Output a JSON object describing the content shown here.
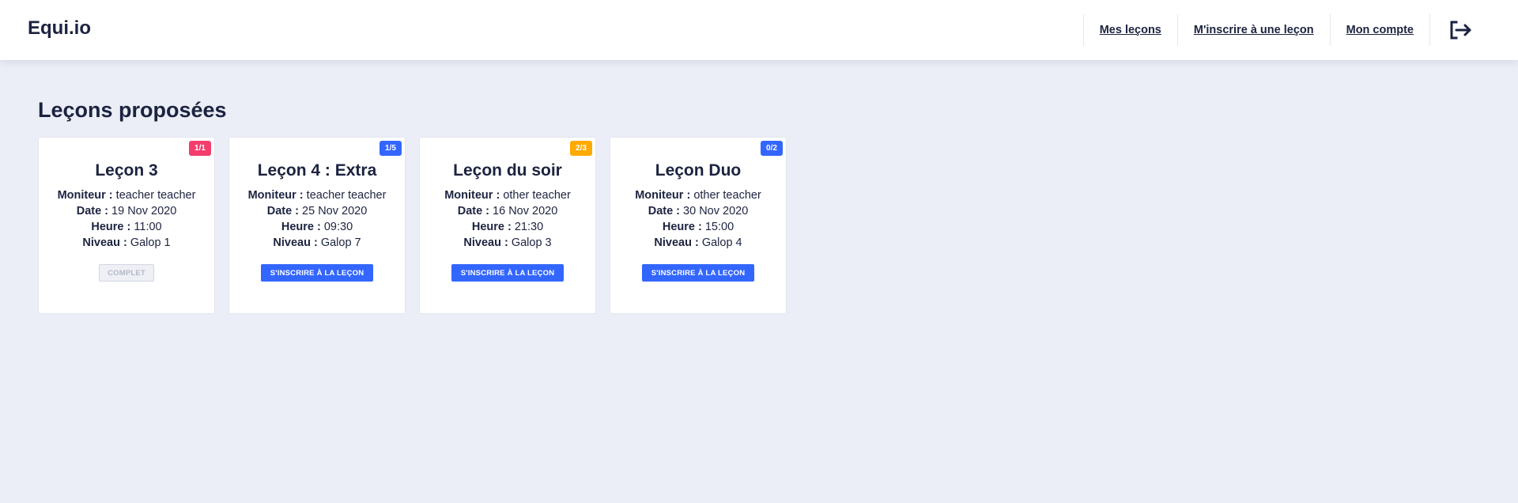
{
  "app": {
    "brand": "Equi.io"
  },
  "nav": {
    "items": [
      {
        "label": "Mes leçons"
      },
      {
        "label": "M'inscrire à une leçon"
      },
      {
        "label": "Mon compte"
      }
    ],
    "logout_icon": "logout-icon"
  },
  "page": {
    "title": "Leçons proposées"
  },
  "labels": {
    "moniteur": "Moniteur :",
    "date": "Date :",
    "heure": "Heure :",
    "niveau": "Niveau :"
  },
  "lessons": [
    {
      "title": "Leçon 3",
      "badge": "1/1",
      "badge_color": "#f23d6d",
      "moniteur": "teacher teacher",
      "date": "19 Nov 2020",
      "heure": "11:00",
      "niveau": "Galop 1",
      "button": "COMPLET",
      "button_state": "disabled"
    },
    {
      "title": "Leçon 4 : Extra",
      "badge": "1/5",
      "badge_color": "#3366ff",
      "moniteur": "teacher teacher",
      "date": "25 Nov 2020",
      "heure": "09:30",
      "niveau": "Galop 7",
      "button": "S'INSCRIRE À LA LEÇON",
      "button_state": "primary"
    },
    {
      "title": "Leçon du soir",
      "badge": "2/3",
      "badge_color": "#ffaa00",
      "moniteur": "other teacher",
      "date": "16 Nov 2020",
      "heure": "21:30",
      "niveau": "Galop 3",
      "button": "S'INSCRIRE À LA LEÇON",
      "button_state": "primary"
    },
    {
      "title": "Leçon Duo",
      "badge": "0/2",
      "badge_color": "#3366ff",
      "moniteur": "other teacher",
      "date": "30 Nov 2020",
      "heure": "15:00",
      "niveau": "Galop 4",
      "button": "S'INSCRIRE À LA LEÇON",
      "button_state": "primary"
    }
  ]
}
